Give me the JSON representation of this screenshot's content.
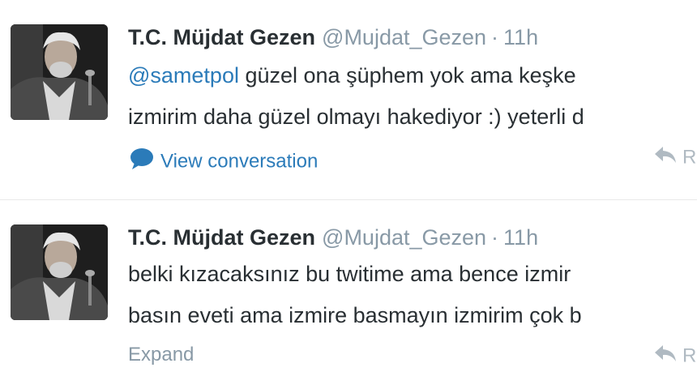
{
  "colors": {
    "link": "#2b7bb9",
    "name": "#292f33",
    "meta": "#8899a6"
  },
  "tweets": [
    {
      "fullname": "T.C. Müjdat Gezen",
      "username": "@Mujdat_Gezen",
      "separator": "·",
      "time": "11h",
      "mention": "@sametpol",
      "line1_rest": " güzel ona şüphem yok ama keşke",
      "line2": "izmirim daha güzel olmayı hakediyor :) yeterli d",
      "action_label": "View conversation",
      "action_icon": "speech-bubble-icon",
      "reply_label": "R",
      "reply_icon": "reply-arrow-icon"
    },
    {
      "fullname": "T.C. Müjdat Gezen",
      "username": "@Mujdat_Gezen",
      "separator": "·",
      "time": "11h",
      "line1": "belki kızacaksınız bu twitime ama bence izmir",
      "line2": "basın eveti ama izmire basmayın izmirim çok b",
      "action_label": "Expand",
      "reply_label": "R",
      "reply_icon": "reply-arrow-icon"
    }
  ]
}
